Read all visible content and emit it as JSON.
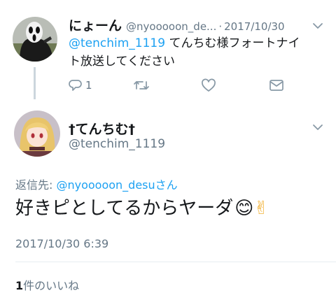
{
  "parent_tweet": {
    "display_name": "にょーん",
    "handle": "@nyooooon_de...",
    "separator": "·",
    "date": "2017/10/30",
    "mention": "@tenchim_1119",
    "text_line1": " てんちむ様フォートナイ",
    "text_line2": "ト放送してください",
    "reply_count": "1",
    "avatar_icon": "ghostface-mask-avatar"
  },
  "main_tweet": {
    "display_name": "†てんちむ†",
    "handle": "@tenchim_1119",
    "reply_to_label": "返信先: ",
    "reply_to_handle": "@nyooooon_desu",
    "reply_to_suffix": "さん",
    "text": "好きピとしてるからヤーダ",
    "emoji_1": "😊",
    "emoji_2": "✌",
    "timestamp": "2017/10/30 6:39",
    "likes_count": "1",
    "likes_label": "件のいいね",
    "avatar_icon": "anime-girl-avatar"
  },
  "colors": {
    "accent": "#1da1f2",
    "secondary_text": "#657786",
    "icon_gray": "#8899a6",
    "thread_line": "#ccd6dd",
    "divider": "#e6ecf0"
  }
}
